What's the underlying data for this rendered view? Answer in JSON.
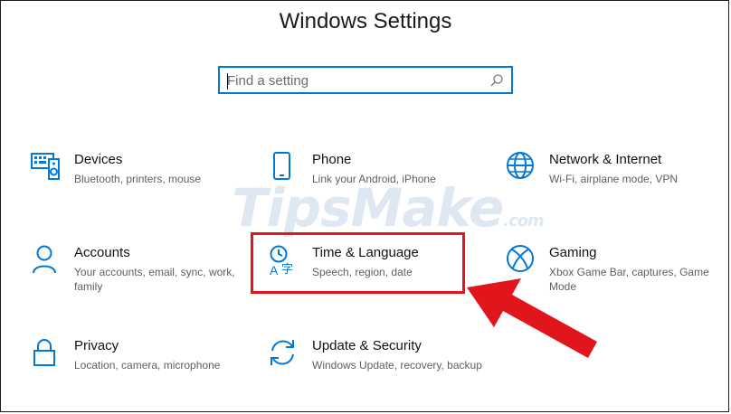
{
  "window": {
    "title": "Windows Settings"
  },
  "search": {
    "placeholder": "Find a setting",
    "icon": "search-icon"
  },
  "watermark": {
    "text": "TipsMake",
    "suffix": ".com"
  },
  "accent_color": "#0078d7",
  "highlight_color": "#e1161c",
  "tiles": [
    {
      "label": "Devices",
      "desc": "Bluetooth, printers, mouse",
      "icon": "keyboard-speaker-icon"
    },
    {
      "label": "Phone",
      "desc": "Link your Android, iPhone",
      "icon": "phone-icon"
    },
    {
      "label": "Network & Internet",
      "desc": "Wi-Fi, airplane mode, VPN",
      "icon": "globe-icon"
    },
    {
      "label": "Accounts",
      "desc": "Your accounts, email, sync, work, family",
      "icon": "person-icon"
    },
    {
      "label": "Time & Language",
      "desc": "Speech, region, date",
      "icon": "time-language-icon"
    },
    {
      "label": "Gaming",
      "desc": "Xbox Game Bar, captures, Game Mode",
      "icon": "xbox-icon"
    },
    {
      "label": "Privacy",
      "desc": "Location, camera, microphone",
      "icon": "lock-icon"
    },
    {
      "label": "Update & Security",
      "desc": "Windows Update, recovery, backup",
      "icon": "sync-arrows-icon"
    }
  ]
}
